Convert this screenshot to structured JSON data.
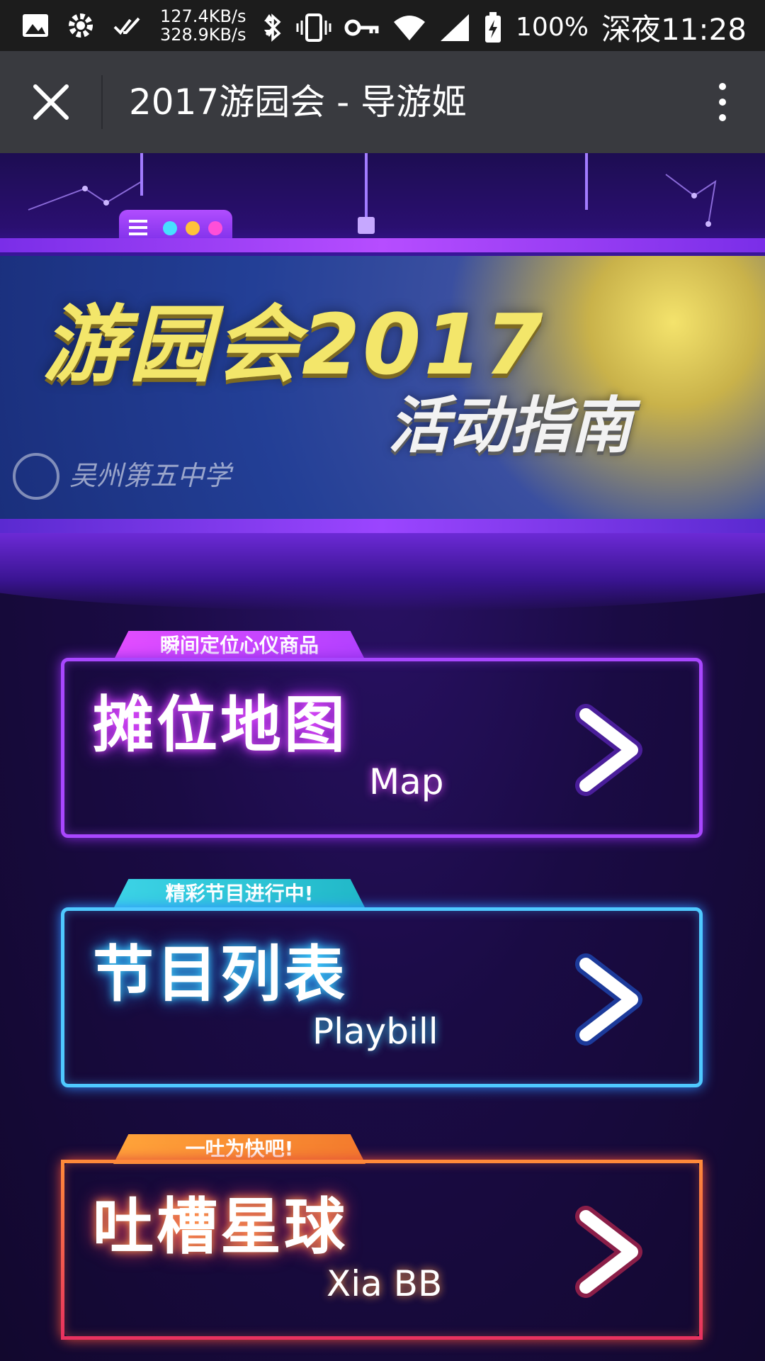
{
  "status_bar": {
    "net_speed_up": "127.4KB/s",
    "net_speed_down": "328.9KB/s",
    "battery_percent": "100%",
    "time": "深夜11:28",
    "icons": [
      "gallery-icon",
      "settings-gear-icon",
      "double-check-icon",
      "network-arrows-icon",
      "bluetooth-icon",
      "vibrate-icon",
      "vpn-key-icon",
      "wifi-icon",
      "cell-signal-icon",
      "battery-charging-icon"
    ]
  },
  "title_bar": {
    "title": "2017游园会 - 导游姬",
    "close_icon": "close-icon",
    "more_icon": "more-vertical-icon",
    "color": "#393a3f"
  },
  "banner": {
    "title": "游园会2017",
    "subtitle": "活动指南",
    "school_name": "吴州第五中学",
    "dot_colors": [
      "#47e0ff",
      "#ffc23a",
      "#ff4fd8"
    ]
  },
  "menu": [
    {
      "tag": "瞬间定位心仪商品",
      "title_cn": "摊位地图",
      "title_en": "Map",
      "color": "#a947ff"
    },
    {
      "tag": "精彩节目进行中!",
      "title_cn": "节目列表",
      "title_en": "Playbill",
      "color": "#4fc9ff"
    },
    {
      "tag": "一吐为快吧!",
      "title_cn": "吐槽星球",
      "title_en": "Xia BB",
      "color": "#ff6a4a"
    }
  ]
}
